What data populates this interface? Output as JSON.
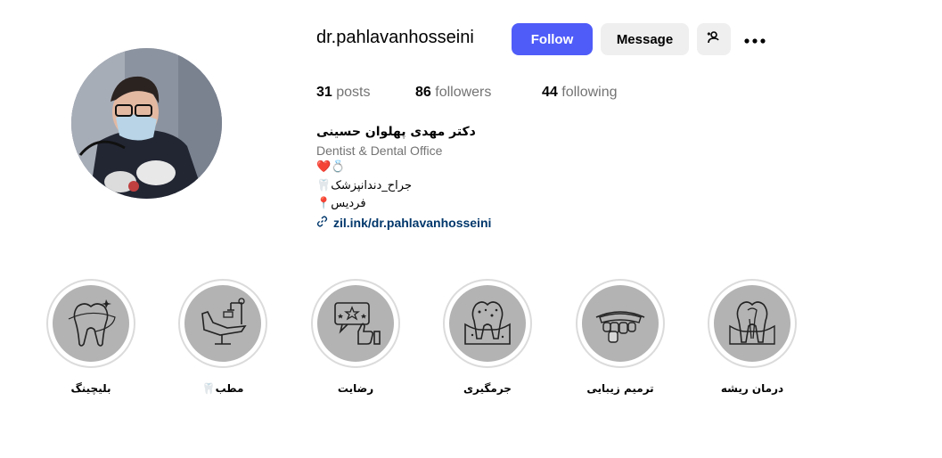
{
  "profile": {
    "username": "dr.pahlavanhosseini",
    "follow_label": "Follow",
    "message_label": "Message",
    "add_user_icon": "add-user-icon",
    "more_icon": "more-options-icon"
  },
  "stats": {
    "posts_count": "31",
    "posts_label": "posts",
    "followers_count": "86",
    "followers_label": "followers",
    "following_count": "44",
    "following_label": "following"
  },
  "bio": {
    "name": "دکتر مهدی پهلوان حسینی",
    "category": "Dentist & Dental Office",
    "emoji_line": "❤️💍",
    "line2": "🦷جراح_دندانپزشک",
    "line3": "📍فردیس",
    "link": "zil.ink/dr.pahlavanhosseini"
  },
  "highlights": [
    {
      "label": "بلیچینگ",
      "icon": "tooth-whitening-icon"
    },
    {
      "label": "🦷مطب",
      "icon": "dental-chair-icon"
    },
    {
      "label": "رضایت",
      "icon": "satisfaction-rating-icon"
    },
    {
      "label": "جرمگیری",
      "icon": "tooth-scaling-icon"
    },
    {
      "label": "ترمیم زیبایی",
      "icon": "cosmetic-restoration-icon"
    },
    {
      "label": "درمان ریشه",
      "icon": "root-canal-icon"
    }
  ],
  "colors": {
    "follow_button": "#4f5cf8",
    "secondary_button": "#efefef",
    "link": "#00376b",
    "muted_text": "#737373",
    "highlight_fill": "#b3b3b3"
  }
}
